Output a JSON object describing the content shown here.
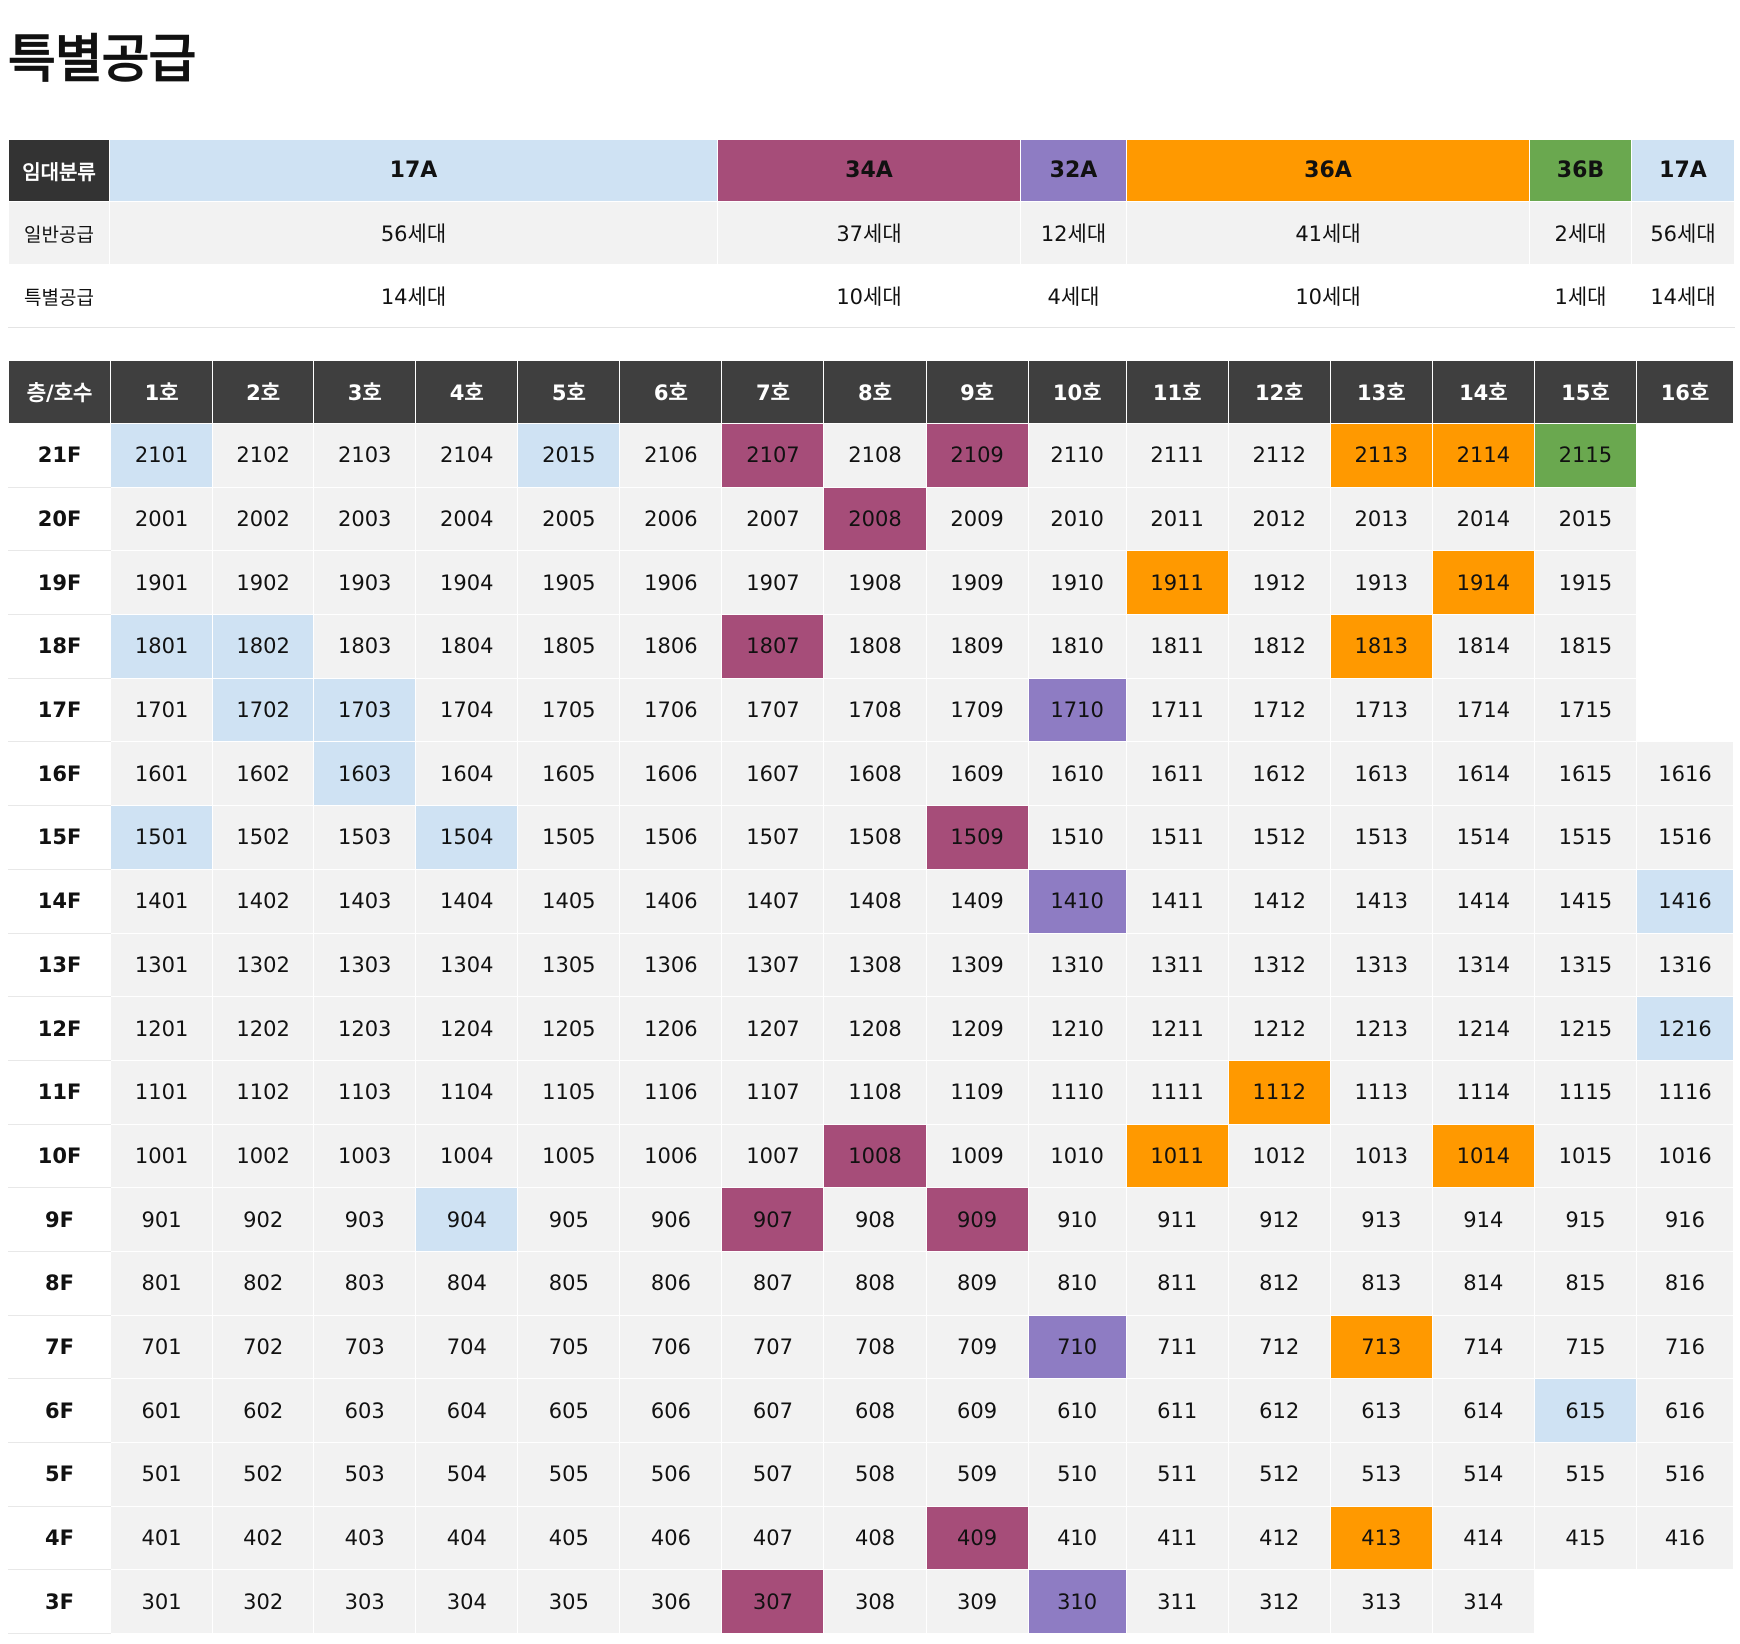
{
  "page": {
    "title": "특별공급"
  },
  "summary": {
    "header_label": "임대분류",
    "row_labels": [
      "일반공급",
      "특별공급"
    ],
    "columns": [
      {
        "type": "17A",
        "color": "#cfe2f3",
        "general": "56세대",
        "special": "14세대"
      },
      {
        "type": "34A",
        "color": "#a64d79",
        "general": "37세대",
        "special": "10세대"
      },
      {
        "type": "32A",
        "color": "#8e7cc3",
        "general": "12세대",
        "special": "4세대"
      },
      {
        "type": "36A",
        "color": "#ff9900",
        "general": "41세대",
        "special": "10세대"
      },
      {
        "type": "36B",
        "color": "#6aa84f",
        "general": "2세대",
        "special": "1세대"
      },
      {
        "type": "17A",
        "color": "#cfe2f3",
        "general": "56세대",
        "special": "14세대"
      }
    ]
  },
  "grid": {
    "header_label": "층/호수",
    "columns": [
      "1호",
      "2호",
      "3호",
      "4호",
      "5호",
      "6호",
      "7호",
      "8호",
      "9호",
      "10호",
      "11호",
      "12호",
      "13호",
      "14호",
      "15호",
      "16호"
    ],
    "rows": [
      {
        "floor": "21F",
        "units": [
          "2101",
          "2102",
          "2103",
          "2104",
          "2015",
          "2106",
          "2107",
          "2108",
          "2109",
          "2110",
          "2111",
          "2112",
          "2113",
          "2114",
          "2115",
          ""
        ],
        "types": [
          "17A",
          "",
          "",
          "",
          "17A",
          "",
          "34A",
          "",
          "34A",
          "",
          "",
          "",
          "36A",
          "36A",
          "36B",
          ""
        ]
      },
      {
        "floor": "20F",
        "units": [
          "2001",
          "2002",
          "2003",
          "2004",
          "2005",
          "2006",
          "2007",
          "2008",
          "2009",
          "2010",
          "2011",
          "2012",
          "2013",
          "2014",
          "2015",
          ""
        ],
        "types": [
          "",
          "",
          "",
          "",
          "",
          "",
          "",
          "34A",
          "",
          "",
          "",
          "",
          "",
          "",
          "",
          ""
        ]
      },
      {
        "floor": "19F",
        "units": [
          "1901",
          "1902",
          "1903",
          "1904",
          "1905",
          "1906",
          "1907",
          "1908",
          "1909",
          "1910",
          "1911",
          "1912",
          "1913",
          "1914",
          "1915",
          ""
        ],
        "types": [
          "",
          "",
          "",
          "",
          "",
          "",
          "",
          "",
          "",
          "",
          "36A",
          "",
          "",
          "36A",
          "",
          ""
        ]
      },
      {
        "floor": "18F",
        "units": [
          "1801",
          "1802",
          "1803",
          "1804",
          "1805",
          "1806",
          "1807",
          "1808",
          "1809",
          "1810",
          "1811",
          "1812",
          "1813",
          "1814",
          "1815",
          ""
        ],
        "types": [
          "17A",
          "17A",
          "",
          "",
          "",
          "",
          "34A",
          "",
          "",
          "",
          "",
          "",
          "36A",
          "",
          "",
          ""
        ]
      },
      {
        "floor": "17F",
        "units": [
          "1701",
          "1702",
          "1703",
          "1704",
          "1705",
          "1706",
          "1707",
          "1708",
          "1709",
          "1710",
          "1711",
          "1712",
          "1713",
          "1714",
          "1715",
          ""
        ],
        "types": [
          "",
          "17A",
          "17A",
          "",
          "",
          "",
          "",
          "",
          "",
          "32A",
          "",
          "",
          "",
          "",
          "",
          ""
        ]
      },
      {
        "floor": "16F",
        "units": [
          "1601",
          "1602",
          "1603",
          "1604",
          "1605",
          "1606",
          "1607",
          "1608",
          "1609",
          "1610",
          "1611",
          "1612",
          "1613",
          "1614",
          "1615",
          "1616"
        ],
        "types": [
          "",
          "",
          "17A",
          "",
          "",
          "",
          "",
          "",
          "",
          "",
          "",
          "",
          "",
          "",
          "",
          ""
        ]
      },
      {
        "floor": "15F",
        "units": [
          "1501",
          "1502",
          "1503",
          "1504",
          "1505",
          "1506",
          "1507",
          "1508",
          "1509",
          "1510",
          "1511",
          "1512",
          "1513",
          "1514",
          "1515",
          "1516"
        ],
        "types": [
          "17A",
          "",
          "",
          "17A",
          "",
          "",
          "",
          "",
          "34A",
          "",
          "",
          "",
          "",
          "",
          "",
          ""
        ]
      },
      {
        "floor": "14F",
        "units": [
          "1401",
          "1402",
          "1403",
          "1404",
          "1405",
          "1406",
          "1407",
          "1408",
          "1409",
          "1410",
          "1411",
          "1412",
          "1413",
          "1414",
          "1415",
          "1416"
        ],
        "types": [
          "",
          "",
          "",
          "",
          "",
          "",
          "",
          "",
          "",
          "32A",
          "",
          "",
          "",
          "",
          "",
          "17A"
        ]
      },
      {
        "floor": "13F",
        "units": [
          "1301",
          "1302",
          "1303",
          "1304",
          "1305",
          "1306",
          "1307",
          "1308",
          "1309",
          "1310",
          "1311",
          "1312",
          "1313",
          "1314",
          "1315",
          "1316"
        ],
        "types": [
          "",
          "",
          "",
          "",
          "",
          "",
          "",
          "",
          "",
          "",
          "",
          "",
          "",
          "",
          "",
          ""
        ]
      },
      {
        "floor": "12F",
        "units": [
          "1201",
          "1202",
          "1203",
          "1204",
          "1205",
          "1206",
          "1207",
          "1208",
          "1209",
          "1210",
          "1211",
          "1212",
          "1213",
          "1214",
          "1215",
          "1216"
        ],
        "types": [
          "",
          "",
          "",
          "",
          "",
          "",
          "",
          "",
          "",
          "",
          "",
          "",
          "",
          "",
          "",
          "17A"
        ]
      },
      {
        "floor": "11F",
        "units": [
          "1101",
          "1102",
          "1103",
          "1104",
          "1105",
          "1106",
          "1107",
          "1108",
          "1109",
          "1110",
          "1111",
          "1112",
          "1113",
          "1114",
          "1115",
          "1116"
        ],
        "types": [
          "",
          "",
          "",
          "",
          "",
          "",
          "",
          "",
          "",
          "",
          "",
          "36A",
          "",
          "",
          "",
          ""
        ]
      },
      {
        "floor": "10F",
        "units": [
          "1001",
          "1002",
          "1003",
          "1004",
          "1005",
          "1006",
          "1007",
          "1008",
          "1009",
          "1010",
          "1011",
          "1012",
          "1013",
          "1014",
          "1015",
          "1016"
        ],
        "types": [
          "",
          "",
          "",
          "",
          "",
          "",
          "",
          "34A",
          "",
          "",
          "36A",
          "",
          "",
          "36A",
          "",
          ""
        ]
      },
      {
        "floor": "9F",
        "units": [
          "901",
          "902",
          "903",
          "904",
          "905",
          "906",
          "907",
          "908",
          "909",
          "910",
          "911",
          "912",
          "913",
          "914",
          "915",
          "916"
        ],
        "types": [
          "",
          "",
          "",
          "17A",
          "",
          "",
          "34A",
          "",
          "34A",
          "",
          "",
          "",
          "",
          "",
          "",
          ""
        ]
      },
      {
        "floor": "8F",
        "units": [
          "801",
          "802",
          "803",
          "804",
          "805",
          "806",
          "807",
          "808",
          "809",
          "810",
          "811",
          "812",
          "813",
          "814",
          "815",
          "816"
        ],
        "types": [
          "",
          "",
          "",
          "",
          "",
          "",
          "",
          "",
          "",
          "",
          "",
          "",
          "",
          "",
          "",
          ""
        ]
      },
      {
        "floor": "7F",
        "units": [
          "701",
          "702",
          "703",
          "704",
          "705",
          "706",
          "707",
          "708",
          "709",
          "710",
          "711",
          "712",
          "713",
          "714",
          "715",
          "716"
        ],
        "types": [
          "",
          "",
          "",
          "",
          "",
          "",
          "",
          "",
          "",
          "32A",
          "",
          "",
          "36A",
          "",
          "",
          ""
        ]
      },
      {
        "floor": "6F",
        "units": [
          "601",
          "602",
          "603",
          "604",
          "605",
          "606",
          "607",
          "608",
          "609",
          "610",
          "611",
          "612",
          "613",
          "614",
          "615",
          "616"
        ],
        "types": [
          "",
          "",
          "",
          "",
          "",
          "",
          "",
          "",
          "",
          "",
          "",
          "",
          "",
          "",
          "17A",
          ""
        ]
      },
      {
        "floor": "5F",
        "units": [
          "501",
          "502",
          "503",
          "504",
          "505",
          "506",
          "507",
          "508",
          "509",
          "510",
          "511",
          "512",
          "513",
          "514",
          "515",
          "516"
        ],
        "types": [
          "",
          "",
          "",
          "",
          "",
          "",
          "",
          "",
          "",
          "",
          "",
          "",
          "",
          "",
          "",
          ""
        ]
      },
      {
        "floor": "4F",
        "units": [
          "401",
          "402",
          "403",
          "404",
          "405",
          "406",
          "407",
          "408",
          "409",
          "410",
          "411",
          "412",
          "413",
          "414",
          "415",
          "416"
        ],
        "types": [
          "",
          "",
          "",
          "",
          "",
          "",
          "",
          "",
          "34A",
          "",
          "",
          "",
          "36A",
          "",
          "",
          ""
        ]
      },
      {
        "floor": "3F",
        "units": [
          "301",
          "302",
          "303",
          "304",
          "305",
          "306",
          "307",
          "308",
          "309",
          "310",
          "311",
          "312",
          "313",
          "314",
          "",
          ""
        ],
        "types": [
          "",
          "",
          "",
          "",
          "",
          "",
          "34A",
          "",
          "",
          "32A",
          "",
          "",
          "",
          "",
          "",
          ""
        ]
      }
    ]
  }
}
